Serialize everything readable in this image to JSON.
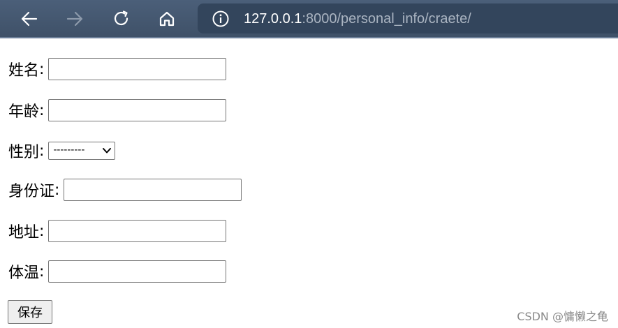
{
  "browser": {
    "back_icon": "arrow-left-icon",
    "forward_icon": "arrow-right-icon",
    "reload_icon": "reload-icon",
    "home_icon": "home-icon",
    "info_icon": "info-icon",
    "url_host": "127.0.0.1",
    "url_rest": ":8000/personal_info/craete/",
    "colors": {
      "toolbar": "#44576f",
      "address_bar": "#33455c",
      "icon_active": "#ffffff",
      "icon_disabled": "#8d9aab"
    }
  },
  "form": {
    "colon": ":",
    "fields": {
      "name": {
        "label": "姓名",
        "value": ""
      },
      "age": {
        "label": "年龄",
        "value": ""
      },
      "gender": {
        "label": "性别",
        "selected": "---------"
      },
      "id_card": {
        "label": "身份证",
        "value": ""
      },
      "address": {
        "label": "地址",
        "value": ""
      },
      "temperature": {
        "label": "体温",
        "value": ""
      }
    },
    "save_label": "保存"
  },
  "watermark": "CSDN @慵懒之龟"
}
